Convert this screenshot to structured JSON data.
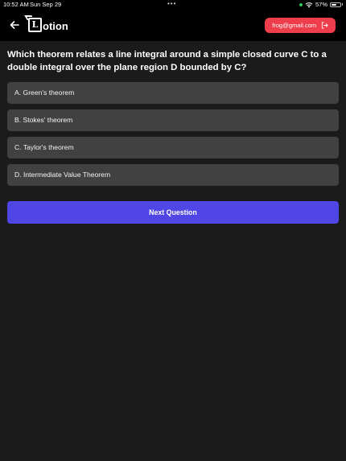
{
  "status_bar": {
    "time": "10:52 AM",
    "date": "Sun Sep 29",
    "battery": "57%",
    "battery_level": 0.57
  },
  "header": {
    "logo_letter": "L",
    "logo_text": "otion",
    "email": "frog@gmail.com",
    "back_icon": "arrow-left-icon",
    "logout_icon": "logout-icon"
  },
  "question": {
    "text": "Which theorem relates a line integral around a simple closed curve C to a double integral over the plane region D bounded by C?",
    "options": [
      "A. Green's theorem",
      "B. Stokes' theorem",
      "C. Taylor's theorem",
      "D. Intermediate Value Theorem"
    ]
  },
  "actions": {
    "next_label": "Next Question"
  },
  "colors": {
    "background": "#1b1b1b",
    "header": "#000000",
    "option": "#414141",
    "email_button": "#ef3e4b",
    "next_button": "#4f46e5"
  }
}
